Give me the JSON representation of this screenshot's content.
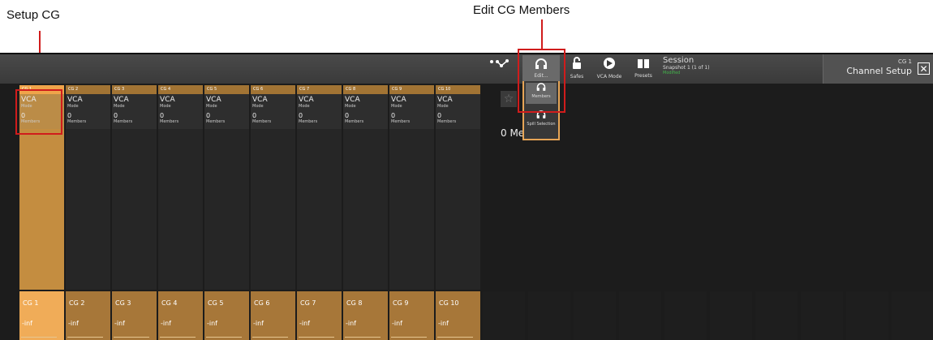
{
  "annotations": {
    "setup_cg": "Setup CG",
    "edit_members": "Edit CG Members"
  },
  "toolbar": {
    "routing": {
      "icon": "routing-nodes-icon"
    },
    "edit": {
      "icon": "headphones-icon",
      "label": "Edit..."
    },
    "safes": {
      "icon": "padlock-icon",
      "label": "Safes"
    },
    "vca_mode": {
      "icon": "vca-mode-icon",
      "label": "VCA Mode"
    },
    "presets": {
      "icon": "book-icon",
      "label": "Presets"
    }
  },
  "session": {
    "title": "Session",
    "snapshot": "Snapshot 1 (1 of 1)",
    "status": "Modified"
  },
  "channel_setup": {
    "cg": "CG 1",
    "title": "Channel Setup",
    "close": "✕"
  },
  "dropdown": {
    "members": {
      "icon": "headphones-icon",
      "label": "Members"
    },
    "spill": {
      "icon": "headphones-icon",
      "label": "Spill Selection"
    }
  },
  "detail": {
    "star": "☆",
    "members_count": "0 Me"
  },
  "strips": [
    {
      "header": "CG 1",
      "mode": "VCA",
      "mode_sub": "Mode",
      "count": "0",
      "count_sub": "Members",
      "name": "CG 1",
      "value": "-inf",
      "selected": true
    },
    {
      "header": "CG 2",
      "mode": "VCA",
      "mode_sub": "Mode",
      "count": "0",
      "count_sub": "Members",
      "name": "CG 2",
      "value": "-inf",
      "selected": false
    },
    {
      "header": "CG 3",
      "mode": "VCA",
      "mode_sub": "Mode",
      "count": "0",
      "count_sub": "Members",
      "name": "CG 3",
      "value": "-inf",
      "selected": false
    },
    {
      "header": "CG 4",
      "mode": "VCA",
      "mode_sub": "Mode",
      "count": "0",
      "count_sub": "Members",
      "name": "CG 4",
      "value": "-inf",
      "selected": false
    },
    {
      "header": "CG 5",
      "mode": "VCA",
      "mode_sub": "Mode",
      "count": "0",
      "count_sub": "Members",
      "name": "CG 5",
      "value": "-inf",
      "selected": false
    },
    {
      "header": "CG 6",
      "mode": "VCA",
      "mode_sub": "Mode",
      "count": "0",
      "count_sub": "Members",
      "name": "CG 6",
      "value": "-inf",
      "selected": false
    },
    {
      "header": "CG 7",
      "mode": "VCA",
      "mode_sub": "Mode",
      "count": "0",
      "count_sub": "Members",
      "name": "CG 7",
      "value": "-inf",
      "selected": false
    },
    {
      "header": "CG 8",
      "mode": "VCA",
      "mode_sub": "Mode",
      "count": "0",
      "count_sub": "Members",
      "name": "CG 8",
      "value": "-inf",
      "selected": false
    },
    {
      "header": "CG 9",
      "mode": "VCA",
      "mode_sub": "Mode",
      "count": "0",
      "count_sub": "Members",
      "name": "CG 9",
      "value": "-inf",
      "selected": false
    },
    {
      "header": "CG 10",
      "mode": "VCA",
      "mode_sub": "Mode",
      "count": "0",
      "count_sub": "Members",
      "name": "CG 10",
      "value": "-inf",
      "selected": false
    }
  ],
  "colors": {
    "accent": "#f0a44a",
    "strip_header": "#a27434",
    "callout": "#d01c1c"
  }
}
